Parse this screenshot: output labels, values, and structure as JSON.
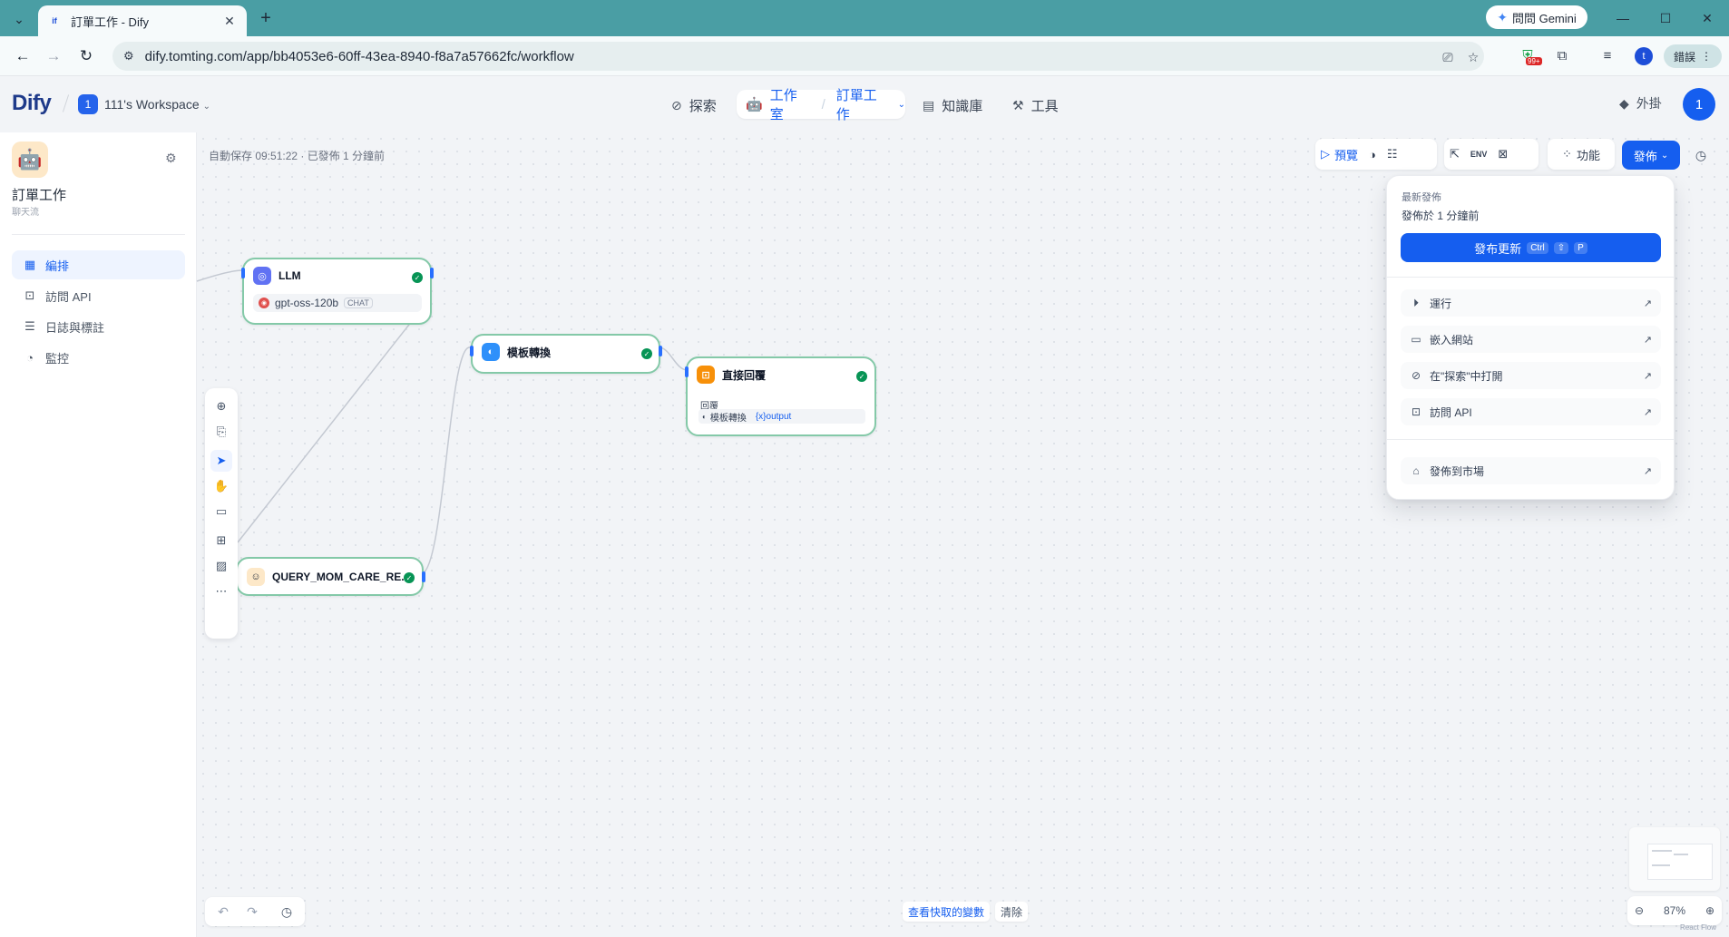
{
  "browser": {
    "tab_title": "訂單工作 - Dify",
    "tab_favicon": "if",
    "new_tab": "+",
    "gemini_label": "問問 Gemini",
    "url": "dify.tomting.com/app/bb4053e6-60ff-43ea-8940-f8a7a57662fc/workflow",
    "profile_initial": "t",
    "sync_label": "錯誤",
    "extension_badge": "99+"
  },
  "header": {
    "logo": "Dify",
    "workspace_badge": "1",
    "workspace_name": "111's Workspace",
    "nav": {
      "explore": "探索",
      "studio": "工作室",
      "current_app": "訂單工作",
      "knowledge": "知識庫",
      "tools": "工具"
    },
    "plugins": "外掛",
    "user_initial": "1"
  },
  "sidebar": {
    "app_name": "訂單工作",
    "app_type": "聊天流",
    "items": [
      {
        "label": "編排",
        "icon": "layout-icon",
        "active": true
      },
      {
        "label": "訪問 API",
        "icon": "terminal-icon",
        "active": false
      },
      {
        "label": "日誌與標註",
        "icon": "file-list-icon",
        "active": false
      },
      {
        "label": "監控",
        "icon": "dashboard-icon",
        "active": false
      }
    ]
  },
  "canvas": {
    "autosave": "自動保存 09:51:22 · 已發佈 1 分鐘前",
    "nodes": {
      "llm": {
        "title": "LLM",
        "model": "gpt-oss-120b",
        "model_tag": "CHAT"
      },
      "template": {
        "title": "模板轉換"
      },
      "answer": {
        "title": "直接回覆",
        "label": "回覆",
        "var_node": "模板轉換",
        "var_name": "{x}output"
      },
      "query": {
        "title": "QUERY_MOM_CARE_RE..."
      }
    },
    "view_cache": "查看快取的變數",
    "clear": "清除",
    "zoom": "87%",
    "attribution": "React Flow"
  },
  "topbar": {
    "preview": "預覽",
    "features": "功能",
    "publish": "發佈"
  },
  "publish_panel": {
    "latest_label": "最新發佈",
    "published_time": "發佈於 1 分鐘前",
    "update_button": "發布更新",
    "shortcut": [
      "Ctrl",
      "⇧",
      "P"
    ],
    "items": [
      {
        "label": "運行",
        "icon": "play-circle-icon"
      },
      {
        "label": "嵌入網站",
        "icon": "embed-window-icon"
      },
      {
        "label": "在\"探索\"中打開",
        "icon": "compass-icon"
      },
      {
        "label": "訪問 API",
        "icon": "terminal-icon"
      }
    ],
    "marketplace": "發佈到市場"
  }
}
